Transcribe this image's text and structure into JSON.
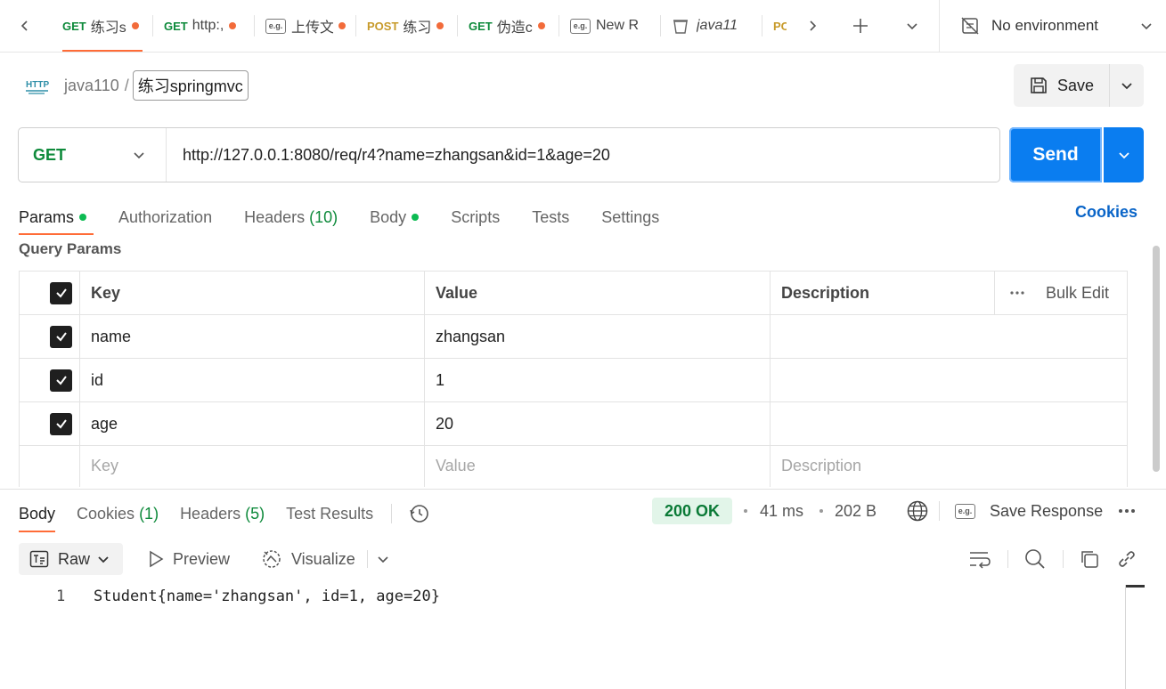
{
  "tabbar": {
    "tabs": [
      {
        "method": "GET",
        "name": "练习s",
        "dirty": true,
        "active": true,
        "kind": "request"
      },
      {
        "method": "GET",
        "name": "http:,",
        "dirty": true,
        "active": false,
        "kind": "request"
      },
      {
        "method": "e.g.",
        "name": "上传文",
        "dirty": true,
        "active": false,
        "kind": "example"
      },
      {
        "method": "POST",
        "name": "练习",
        "dirty": true,
        "active": false,
        "kind": "request"
      },
      {
        "method": "GET",
        "name": "伪造c",
        "dirty": true,
        "active": false,
        "kind": "request"
      },
      {
        "method": "e.g.",
        "name": "New R",
        "dirty": false,
        "active": false,
        "kind": "example"
      },
      {
        "method": "",
        "name": "java11",
        "dirty": false,
        "active": false,
        "kind": "collection"
      },
      {
        "method": "PO",
        "name": "",
        "dirty": false,
        "active": false,
        "kind": "request"
      }
    ],
    "environment_label": "No environment"
  },
  "breadcrumb": {
    "badge": "HTTP",
    "collection": "java110",
    "separator": "/",
    "current": "练习springmvc"
  },
  "save": {
    "label": "Save"
  },
  "request": {
    "method": "GET",
    "url": "http://127.0.0.1:8080/req/r4?name=zhangsan&id=1&age=20",
    "send_label": "Send"
  },
  "request_tabs": [
    {
      "label": "Params",
      "count": "",
      "dot": true,
      "active": true
    },
    {
      "label": "Authorization",
      "count": "",
      "dot": false,
      "active": false
    },
    {
      "label": "Headers",
      "count": "(10)",
      "dot": false,
      "active": false
    },
    {
      "label": "Body",
      "count": "",
      "dot": true,
      "active": false
    },
    {
      "label": "Scripts",
      "count": "",
      "dot": false,
      "active": false
    },
    {
      "label": "Tests",
      "count": "",
      "dot": false,
      "active": false
    },
    {
      "label": "Settings",
      "count": "",
      "dot": false,
      "active": false
    }
  ],
  "cookies_link": "Cookies",
  "params": {
    "section_title": "Query Params",
    "headers": {
      "key": "Key",
      "value": "Value",
      "description": "Description",
      "bulk_edit": "Bulk Edit"
    },
    "rows": [
      {
        "key": "name",
        "value": "zhangsan",
        "description": "",
        "checked": true
      },
      {
        "key": "id",
        "value": "1",
        "description": "",
        "checked": true
      },
      {
        "key": "age",
        "value": "20",
        "description": "",
        "checked": true
      }
    ],
    "placeholders": {
      "key": "Key",
      "value": "Value",
      "description": "Description"
    }
  },
  "response": {
    "tabs": [
      {
        "label": "Body",
        "count": "",
        "active": true
      },
      {
        "label": "Cookies",
        "count": "(1)",
        "active": false
      },
      {
        "label": "Headers",
        "count": "(5)",
        "active": false
      },
      {
        "label": "Test Results",
        "count": "",
        "active": false
      }
    ],
    "status": "200 OK",
    "time": "41 ms",
    "size": "202 B",
    "save_response_label": "Save Response",
    "format": {
      "raw_label": "Raw",
      "preview_label": "Preview",
      "visualize_label": "Visualize"
    },
    "body_lines": [
      {
        "no": "1",
        "text": "Student{name='zhangsan', id=1, age=20}"
      }
    ]
  },
  "colors": {
    "accent_orange": "#ff6c37",
    "get_green": "#0e8a3b",
    "post_yellow": "#c79a2a",
    "send_blue": "#0a7df0",
    "link_blue": "#0a65c8",
    "status_ok_bg": "#e2f5e9"
  },
  "icons": {
    "nav_back": "chevron-left-icon",
    "nav_forward": "chevron-right-icon",
    "new_tab": "plus-icon",
    "tab_list": "chevron-down-icon",
    "environment": "no-environment-icon",
    "save": "floppy-disk-icon",
    "history": "history-icon",
    "globe": "globe-icon",
    "search": "search-icon",
    "copy": "copy-icon",
    "link": "link-icon",
    "wrap": "wrap-lines-icon"
  }
}
